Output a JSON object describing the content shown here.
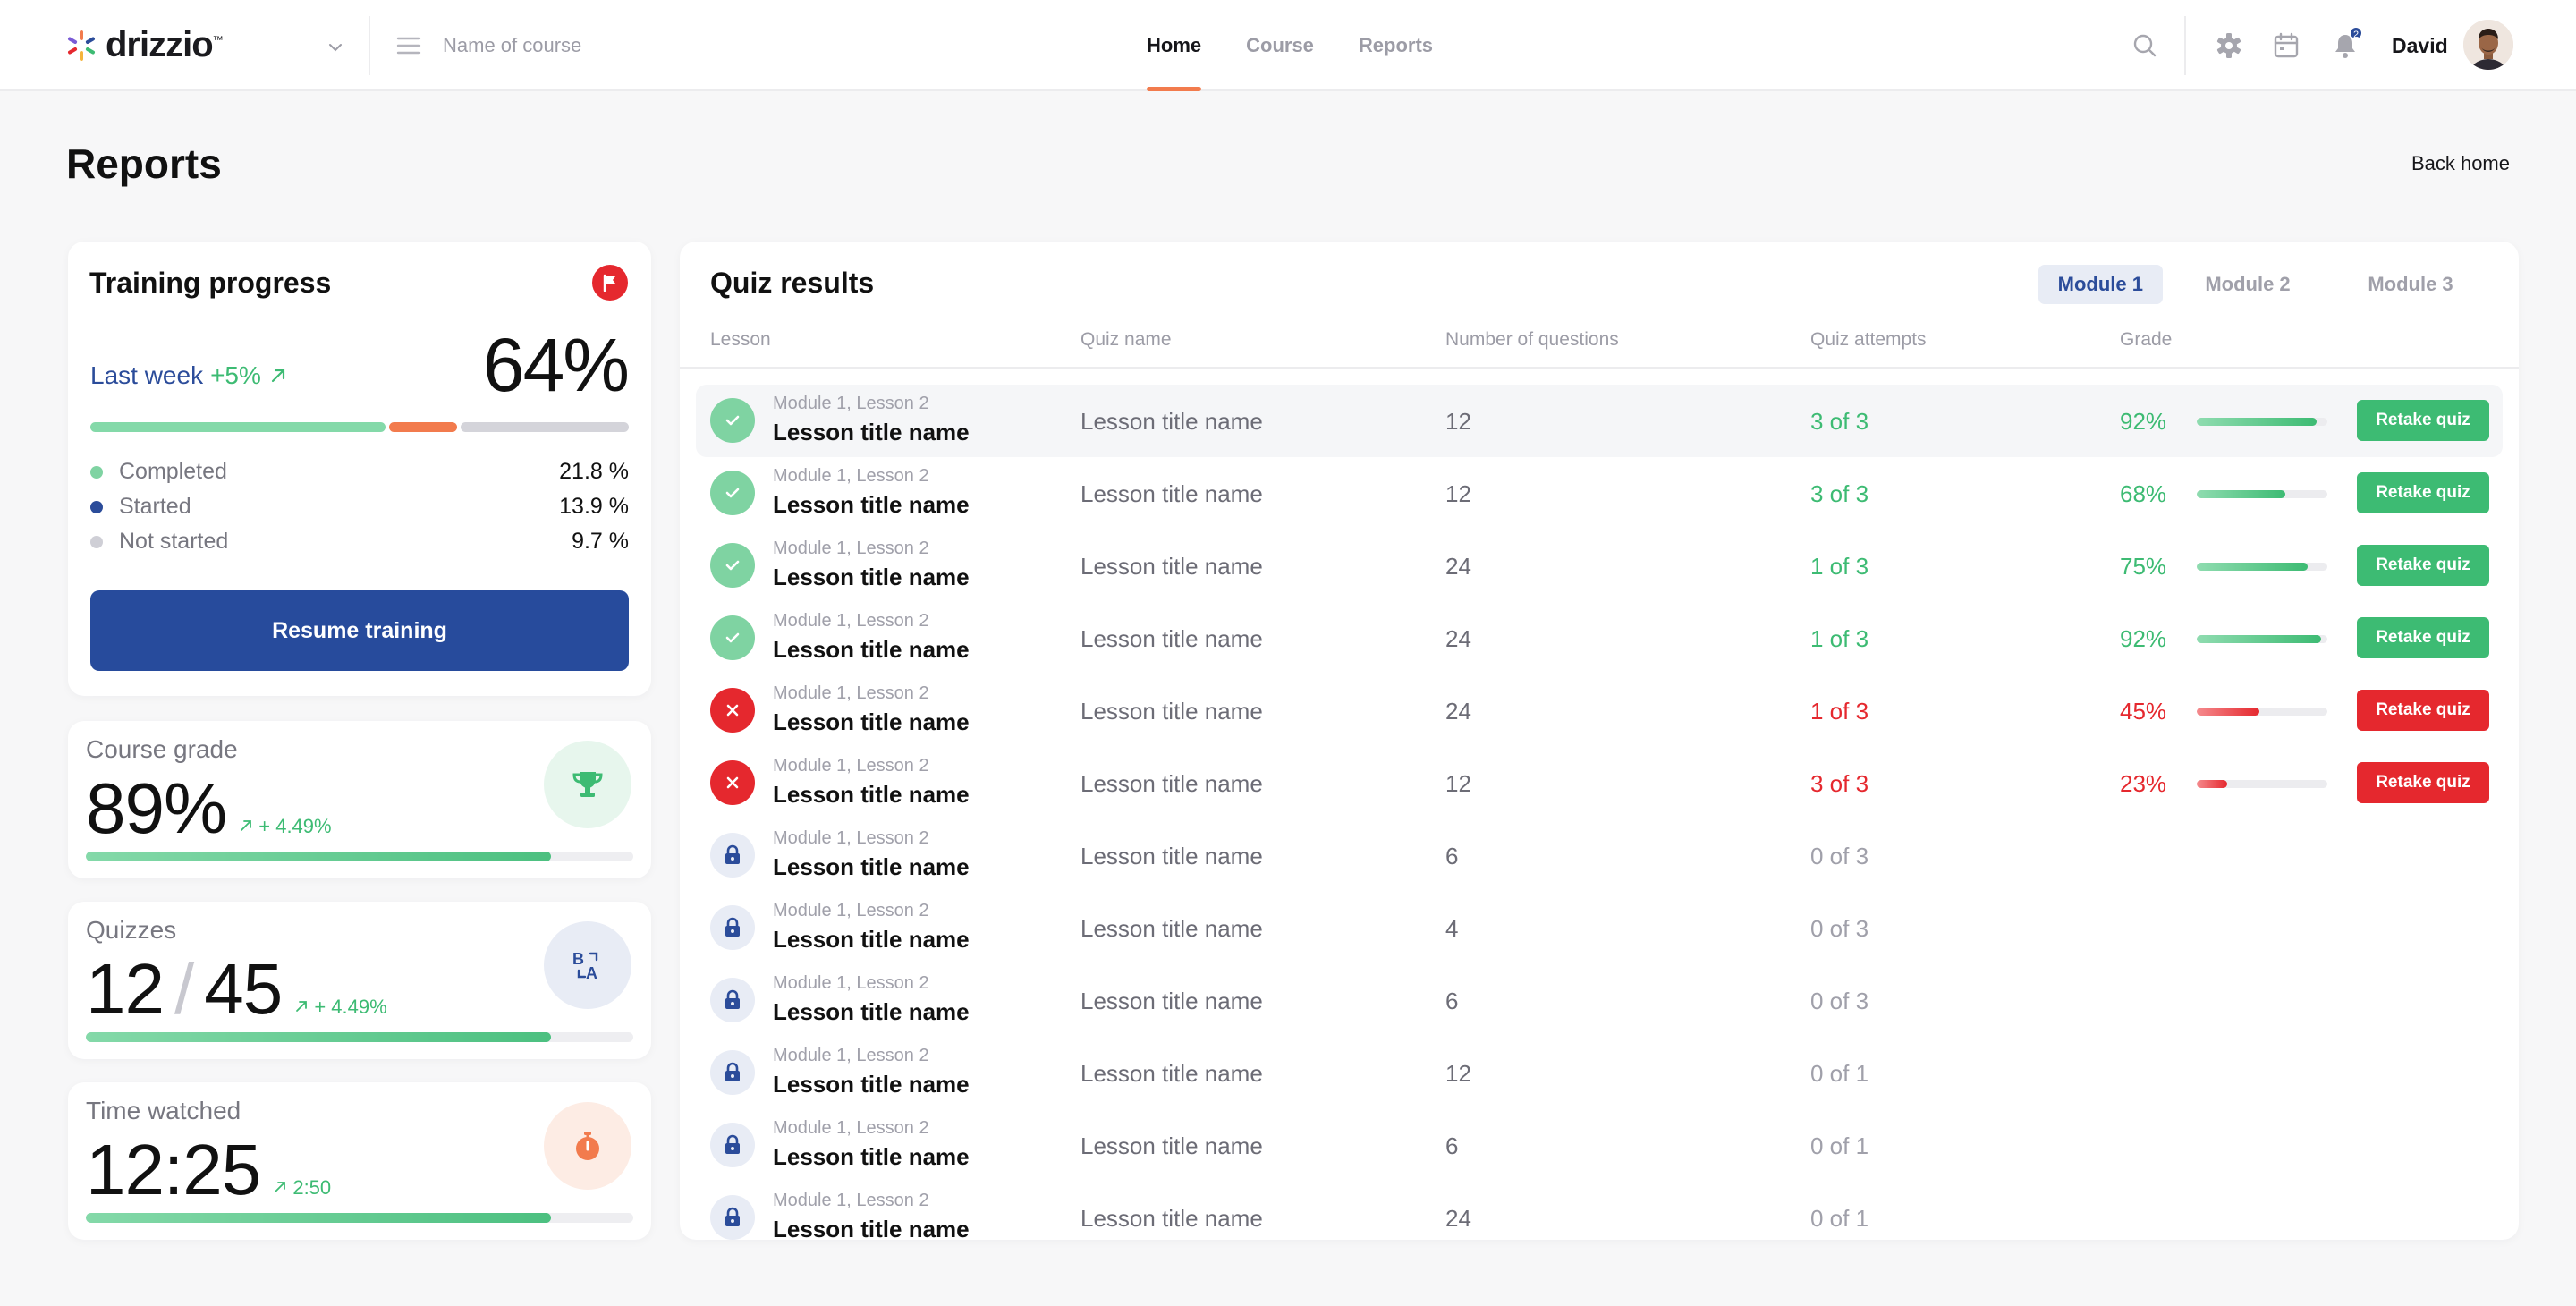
{
  "app": {
    "logo_text": "drizzio",
    "logo_tm": "™",
    "course_placeholder": "Name of course"
  },
  "nav": {
    "tabs": [
      {
        "label": "Home",
        "active": true
      },
      {
        "label": "Course",
        "active": false
      },
      {
        "label": "Reports",
        "active": false
      }
    ]
  },
  "header": {
    "notification_count": "2",
    "user_name": "David"
  },
  "page": {
    "title": "Reports",
    "back_link": "Back home"
  },
  "training": {
    "title": "Training progress",
    "last_week_label": "Last week",
    "last_week_change": "+5%",
    "percent": "64%",
    "legend": [
      {
        "label": "Completed",
        "value": "21.8 %",
        "color": "#7fd3a2"
      },
      {
        "label": "Started",
        "value": "13.9 %",
        "color": "#2b4c9a"
      },
      {
        "label": "Not started",
        "value": "9.7 %",
        "color": "#cfcfd6"
      }
    ],
    "bar_colors": {
      "completed": "#84d9a9",
      "started": "#f27b4d",
      "not_started": "#d4d4da"
    },
    "resume_label": "Resume training"
  },
  "stats": {
    "grade": {
      "label": "Course grade",
      "value": "89%",
      "delta": "+ 4.49%",
      "progress": 0.85
    },
    "quizzes": {
      "label": "Quizzes",
      "value": "12",
      "total": "45",
      "delta": "+ 4.49%",
      "progress": 0.85
    },
    "time": {
      "label": "Time watched",
      "value": "12:25",
      "delta": "2:50",
      "progress": 0.85
    }
  },
  "quiz": {
    "title": "Quiz results",
    "modules": [
      {
        "label": "Module 1",
        "active": true
      },
      {
        "label": "Module 2",
        "active": false
      },
      {
        "label": "Module 3",
        "active": false
      }
    ],
    "columns": {
      "lesson": "Lesson",
      "quiz": "Quiz name",
      "questions": "Number of questions",
      "attempts": "Quiz attempts",
      "grade": "Grade"
    },
    "retake_label": "Retake quiz",
    "rows": [
      {
        "status": "passed",
        "sub": "Module 1, Lesson 2",
        "lesson": "Lesson title name",
        "quiz": "Lesson title name",
        "questions": "12",
        "attempts": "3 of 3",
        "grade": "92%",
        "grade_value": 0.92
      },
      {
        "status": "passed",
        "sub": "Module 1, Lesson 2",
        "lesson": "Lesson title name",
        "quiz": "Lesson title name",
        "questions": "12",
        "attempts": "3 of 3",
        "grade": "68%",
        "grade_value": 0.68
      },
      {
        "status": "passed",
        "sub": "Module 1, Lesson 2",
        "lesson": "Lesson title name",
        "quiz": "Lesson title name",
        "questions": "24",
        "attempts": "1 of 3",
        "grade": "75%",
        "grade_value": 0.85
      },
      {
        "status": "passed",
        "sub": "Module 1, Lesson 2",
        "lesson": "Lesson title name",
        "quiz": "Lesson title name",
        "questions": "24",
        "attempts": "1 of 3",
        "grade": "92%",
        "grade_value": 0.95
      },
      {
        "status": "failed",
        "sub": "Module 1, Lesson 2",
        "lesson": "Lesson title name",
        "quiz": "Lesson title name",
        "questions": "24",
        "attempts": "1 of 3",
        "grade": "45%",
        "grade_value": 0.48
      },
      {
        "status": "failed",
        "sub": "Module 1, Lesson 2",
        "lesson": "Lesson title name",
        "quiz": "Lesson title name",
        "questions": "12",
        "attempts": "3 of 3",
        "grade": "23%",
        "grade_value": 0.23
      },
      {
        "status": "locked",
        "sub": "Module 1, Lesson 2",
        "lesson": "Lesson title name",
        "quiz": "Lesson title name",
        "questions": "6",
        "attempts": "0 of 3"
      },
      {
        "status": "locked",
        "sub": "Module 1, Lesson 2",
        "lesson": "Lesson title name",
        "quiz": "Lesson title name",
        "questions": "4",
        "attempts": "0 of 3"
      },
      {
        "status": "locked",
        "sub": "Module 1, Lesson 2",
        "lesson": "Lesson title name",
        "quiz": "Lesson title name",
        "questions": "6",
        "attempts": "0 of 3"
      },
      {
        "status": "locked",
        "sub": "Module 1, Lesson 2",
        "lesson": "Lesson title name",
        "quiz": "Lesson title name",
        "questions": "12",
        "attempts": "0 of 1"
      },
      {
        "status": "locked",
        "sub": "Module 1, Lesson 2",
        "lesson": "Lesson title name",
        "quiz": "Lesson title name",
        "questions": "6",
        "attempts": "0 of 1"
      },
      {
        "status": "locked",
        "sub": "Module 1, Lesson 2",
        "lesson": "Lesson title name",
        "quiz": "Lesson title name",
        "questions": "24",
        "attempts": "0 of 1"
      }
    ]
  },
  "colors": {
    "accent": "#f27b4d",
    "primary": "#274b9c",
    "success": "#3dbb73",
    "danger": "#e5282e"
  },
  "icons": {
    "logo": "spark-logo-icon",
    "menu": "hamburger-icon",
    "search": "search-icon",
    "settings": "gear-icon",
    "calendar": "calendar-icon",
    "bell": "bell-icon",
    "flag": "flag-icon",
    "grade": "trophy-icon",
    "quizzes": "translate-icon",
    "time": "stopwatch-icon",
    "passed": "check-icon",
    "failed": "x-icon",
    "locked": "lock-icon"
  }
}
